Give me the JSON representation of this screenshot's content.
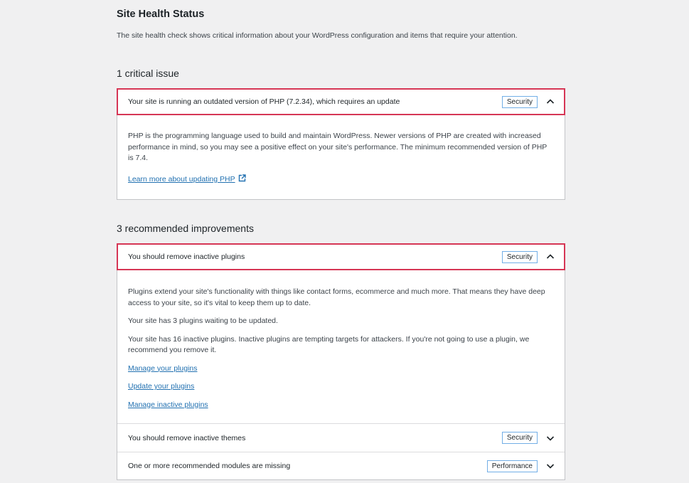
{
  "header": {
    "title": "Site Health Status",
    "description": "The site health check shows critical information about your WordPress configuration and items that require your attention."
  },
  "critical": {
    "heading": "1 critical issue",
    "items": [
      {
        "title": "Your site is running an outdated version of PHP (7.2.34), which requires an update",
        "badge": "Security",
        "expanded": true,
        "body": "PHP is the programming language used to build and maintain WordPress. Newer versions of PHP are created with increased performance in mind, so you may see a positive effect on your site's performance. The minimum recommended version of PHP is 7.4.",
        "link": "Learn more about updating PHP",
        "link_icon": "external-link-icon"
      }
    ]
  },
  "recommended": {
    "heading": "3 recommended improvements",
    "items": [
      {
        "title": "You should remove inactive plugins",
        "badge": "Security",
        "expanded": true,
        "paragraphs": [
          "Plugins extend your site's functionality with things like contact forms, ecommerce and much more. That means they have deep access to your site, so it's vital to keep them up to date.",
          "Your site has 3 plugins waiting to be updated.",
          "Your site has 16 inactive plugins. Inactive plugins are tempting targets for attackers. If you're not going to use a plugin, we recommend you remove it."
        ],
        "links": [
          "Manage your plugins",
          "Update your plugins",
          "Manage inactive plugins"
        ]
      },
      {
        "title": "You should remove inactive themes",
        "badge": "Security",
        "expanded": false
      },
      {
        "title": "One or more recommended modules are missing",
        "badge": "Performance",
        "expanded": false
      }
    ]
  },
  "colors": {
    "focus_outline": "#d63655",
    "badge_border": "#72aee6",
    "link": "#2271b1",
    "background": "#f0f0f1"
  }
}
